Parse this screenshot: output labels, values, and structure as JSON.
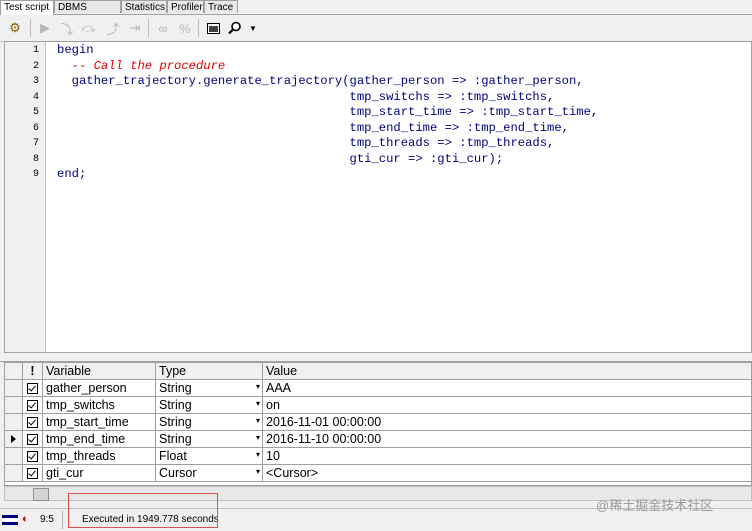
{
  "tabs": [
    {
      "label": "Test script",
      "active": true
    },
    {
      "label": "DBMS Output",
      "active": false
    },
    {
      "label": "Statistics",
      "active": false
    },
    {
      "label": "Profiler",
      "active": false
    },
    {
      "label": "Trace",
      "active": false
    }
  ],
  "toolbar": {
    "icons": [
      "execute-gear-icon",
      "run-icon",
      "step-into-icon",
      "step-over-icon",
      "step-out-icon",
      "run-to-exception-icon",
      "toggle-breakpoint-icon",
      "variables-icon",
      "window-icon",
      "search-icon",
      "dropdown-icon"
    ]
  },
  "editor": {
    "line_numbers": [
      "1",
      "2",
      "3",
      "4",
      "5",
      "6",
      "7",
      "8",
      "9"
    ],
    "lines": [
      "begin",
      "  -- Call the procedure",
      "  gather_trajectory.generate_trajectory(gather_person => :gather_person,",
      "                                        tmp_switchs => :tmp_switchs,",
      "                                        tmp_start_time => :tmp_start_time,",
      "                                        tmp_end_time => :tmp_end_time,",
      "                                        tmp_threads => :tmp_threads,",
      "                                        gti_cur => :gti_cur);",
      "end;"
    ],
    "colors": {
      "keyword": "#000080",
      "comment": "#e00000"
    }
  },
  "grid": {
    "headers": {
      "flag": "!",
      "variable": "Variable",
      "type": "Type",
      "value": "Value"
    },
    "rows": [
      {
        "variable": "gather_person",
        "type": "String",
        "value": "AAA",
        "checked": true,
        "current": false
      },
      {
        "variable": "tmp_switchs",
        "type": "String",
        "value": "on",
        "checked": true,
        "current": false
      },
      {
        "variable": "tmp_start_time",
        "type": "String",
        "value": "2016-11-01 00:00:00",
        "checked": true,
        "current": false
      },
      {
        "variable": "tmp_end_time",
        "type": "String",
        "value": "2016-11-10 00:00:00",
        "checked": true,
        "current": true
      },
      {
        "variable": "tmp_threads",
        "type": "Float",
        "value": "10",
        "checked": true,
        "current": false
      },
      {
        "variable": "gti_cur",
        "type": "Cursor",
        "value": "<Cursor>",
        "checked": true,
        "current": false
      }
    ]
  },
  "status": {
    "position": "9:5",
    "message": "Executed in 1949.778 seconds"
  },
  "watermark": "@稀土掘金技术社区",
  "highlight_color": "#e05050"
}
